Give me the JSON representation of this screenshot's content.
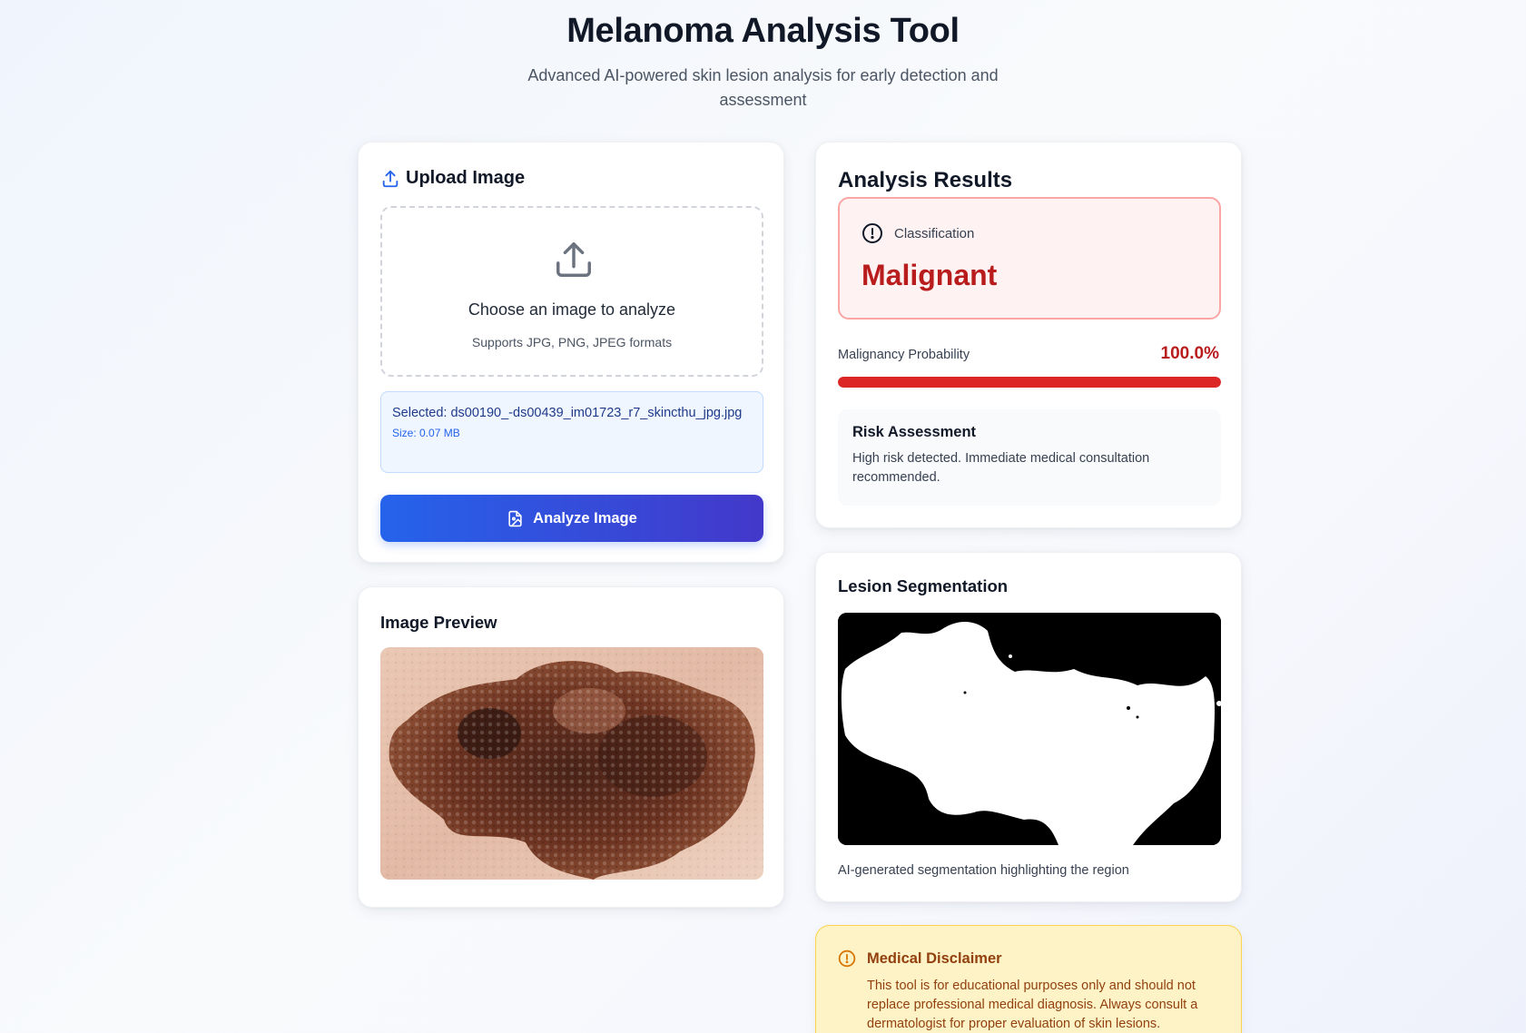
{
  "header": {
    "title": "Melanoma Analysis Tool",
    "subtitle": "Advanced AI-powered skin lesion analysis for early detection and assessment"
  },
  "upload": {
    "heading": "Upload Image",
    "icon": "upload-icon",
    "dropzone_title": "Choose an image to analyze",
    "dropzone_subtitle": "Supports JPG, PNG, JPEG formats",
    "selected_text": "Selected: ds00190_-ds00439_im01723_r7_skincthu_jpg.jpg",
    "size_text": "Size: 0.07 MB",
    "analyze_label": "Analyze Image"
  },
  "preview": {
    "heading": "Image Preview"
  },
  "results": {
    "heading": "Analysis Results",
    "classification_label": "Classification",
    "classification_value": "Malignant",
    "probability_label": "Malignancy Probability",
    "probability_value": "100.0%",
    "probability_fraction": 1.0,
    "risk_title": "Risk Assessment",
    "risk_text": "High risk detected. Immediate medical consultation recommended."
  },
  "segmentation": {
    "heading": "Lesion Segmentation",
    "caption": "AI-generated segmentation highlighting the region"
  },
  "disclaimer": {
    "title": "Medical Disclaimer",
    "text": "This tool is for educational purposes only and should not replace professional medical diagnosis. Always consult a dermatologist for proper evaluation of skin lesions."
  },
  "colors": {
    "primary": "#2563eb",
    "accent": "#4338ca",
    "danger": "#b91c1c",
    "warning_bg": "#fef3c7"
  }
}
